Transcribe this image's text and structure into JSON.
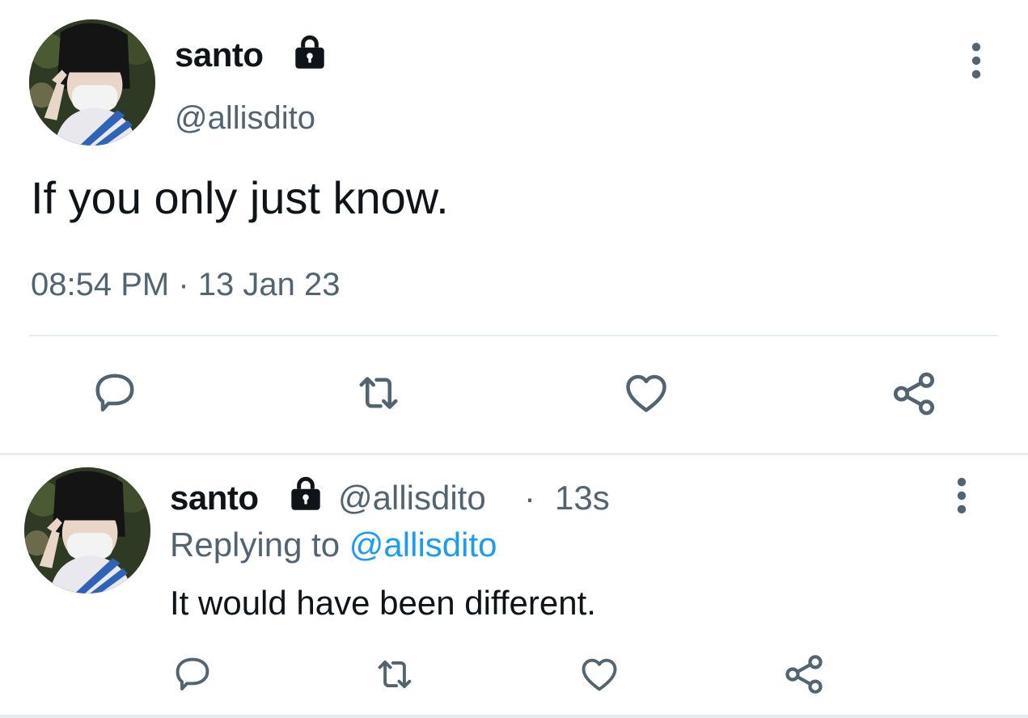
{
  "main_tweet": {
    "display_name": "santo",
    "handle": "@allisdito",
    "text": "If you only just know.",
    "timestamp": "08:54 PM · 13 Jan 23",
    "protected_icon": "lock-icon",
    "actions": [
      "reply-icon",
      "retweet-icon",
      "like-icon",
      "share-icon"
    ]
  },
  "reply_tweet": {
    "display_name": "santo",
    "handle": "@allisdito",
    "separator": "·",
    "time": "13s",
    "replying_prefix": "Replying to",
    "replying_to": "@allisdito",
    "text": "It would have been different.",
    "protected_icon": "lock-icon",
    "actions": [
      "reply-icon",
      "retweet-icon",
      "like-icon",
      "share-icon"
    ]
  },
  "colors": {
    "text_primary": "#0f1419",
    "text_secondary": "#536471",
    "link": "#1d9bf0",
    "divider": "#e6ecf0",
    "icon": "#536471"
  }
}
